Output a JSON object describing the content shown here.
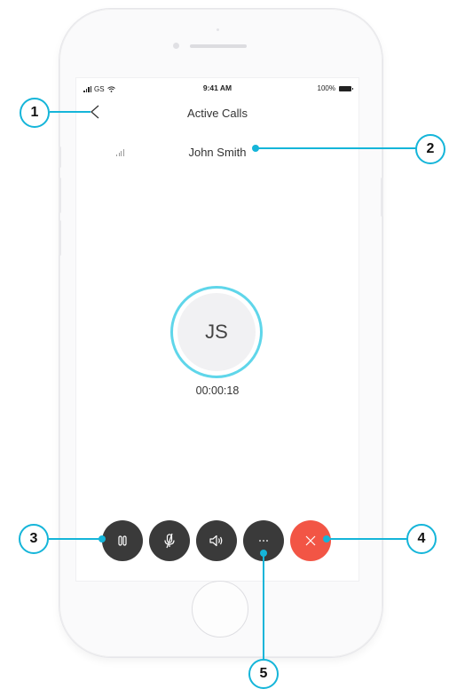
{
  "status_bar": {
    "carrier": "GS",
    "time": "9:41 AM",
    "battery": "100%"
  },
  "header": {
    "back_icon": "chevron-left-icon",
    "title": "Active Calls"
  },
  "call": {
    "caller_name": "John Smith",
    "avatar_initials": "JS",
    "duration": "00:00:18",
    "ring_color": "#5fd6ea"
  },
  "controls": [
    {
      "id": "hold",
      "icon": "pause-icon",
      "color": "#3a3a3a"
    },
    {
      "id": "mute",
      "icon": "mic-off-icon",
      "color": "#3a3a3a"
    },
    {
      "id": "speaker",
      "icon": "speaker-icon",
      "color": "#3a3a3a"
    },
    {
      "id": "more",
      "icon": "more-icon",
      "color": "#3a3a3a"
    },
    {
      "id": "end",
      "icon": "close-icon",
      "color": "#f25545"
    }
  ],
  "callouts": [
    "1",
    "2",
    "3",
    "4",
    "5"
  ],
  "accent_color": "#15b5d9"
}
